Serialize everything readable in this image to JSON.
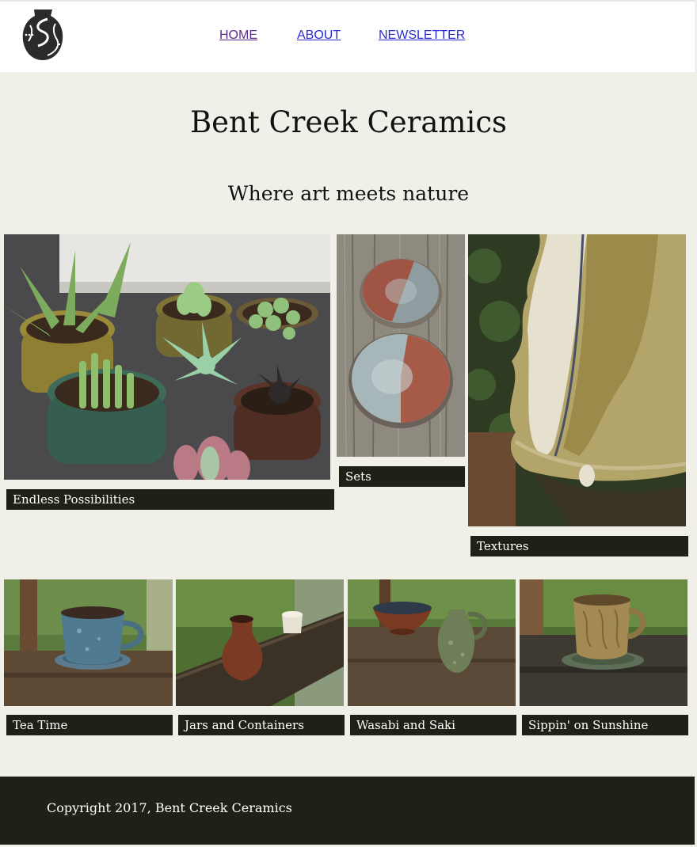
{
  "header": {
    "logo_name": "vase-logo",
    "nav": [
      {
        "label": "HOME",
        "state": "visited"
      },
      {
        "label": "ABOUT",
        "state": "default"
      },
      {
        "label": "NEWSLETTER",
        "state": "default"
      }
    ]
  },
  "hero": {
    "title": "Bent Creek Ceramics",
    "tagline": "Where art meets nature"
  },
  "gallery": {
    "featured": [
      {
        "caption": "Endless Possibilities"
      },
      {
        "caption": "Sets"
      },
      {
        "caption": "Textures"
      }
    ],
    "thumbnails": [
      {
        "caption": "Tea Time"
      },
      {
        "caption": "Jars and Containers"
      },
      {
        "caption": "Wasabi and Saki"
      },
      {
        "caption": "Sippin' on Sunshine"
      }
    ]
  },
  "footer": {
    "copyright": "Copyright 2017, Bent Creek Ceramics"
  },
  "colors": {
    "page_background": "#f0efe8",
    "caption_background": "#1e2216",
    "link": "#2a2ad8",
    "link_visited": "#5a2c86"
  }
}
